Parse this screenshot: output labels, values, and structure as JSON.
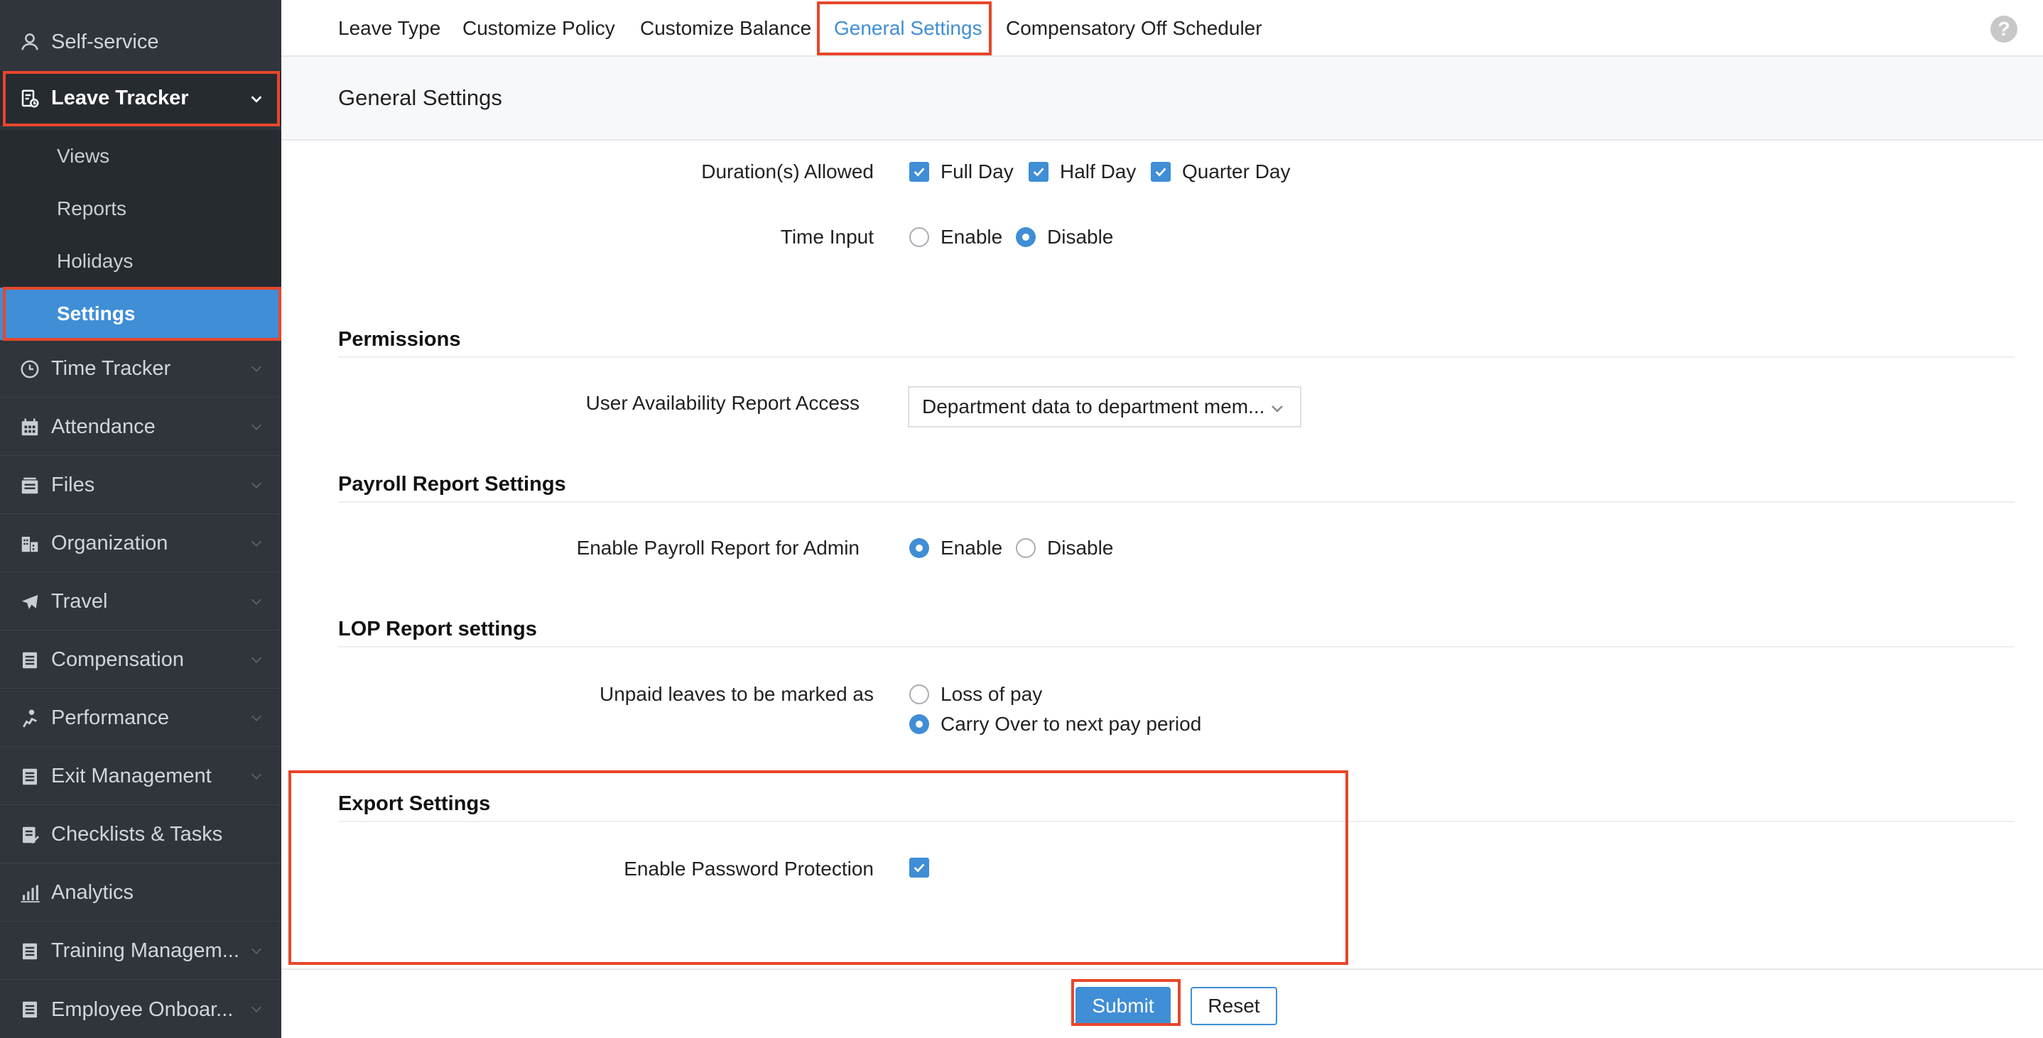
{
  "sidebar": {
    "items": [
      {
        "label": "Self-service",
        "icon": "user-icon"
      },
      {
        "label": "Leave Tracker",
        "icon": "leave-tracker-icon"
      },
      {
        "label": "Time Tracker",
        "icon": "clock-icon"
      },
      {
        "label": "Attendance",
        "icon": "calendar-icon"
      },
      {
        "label": "Files",
        "icon": "files-icon"
      },
      {
        "label": "Organization",
        "icon": "organization-icon"
      },
      {
        "label": "Travel",
        "icon": "plane-icon"
      },
      {
        "label": "Compensation",
        "icon": "document-icon"
      },
      {
        "label": "Performance",
        "icon": "performance-icon"
      },
      {
        "label": "Exit Management",
        "icon": "document-icon"
      },
      {
        "label": "Checklists & Tasks",
        "icon": "checklist-icon"
      },
      {
        "label": "Analytics",
        "icon": "analytics-icon"
      },
      {
        "label": "Training Managem...",
        "icon": "document-icon"
      },
      {
        "label": "Employee Onboar...",
        "icon": "document-icon"
      }
    ],
    "subitems": [
      {
        "label": "Views"
      },
      {
        "label": "Reports"
      },
      {
        "label": "Holidays"
      },
      {
        "label": "Settings"
      }
    ]
  },
  "tabs": [
    "Leave Type",
    "Customize Policy",
    "Customize Balance",
    "General Settings",
    "Compensatory Off Scheduler"
  ],
  "help_label": "?",
  "page_title": "General Settings",
  "duration": {
    "label": "Duration(s) Allowed",
    "options": [
      "Full Day",
      "Half Day",
      "Quarter Day"
    ]
  },
  "time_input": {
    "label": "Time Input",
    "options": [
      "Enable",
      "Disable"
    ],
    "selected": "Disable"
  },
  "permissions": {
    "heading": "Permissions",
    "label": "User Availability Report Access",
    "value": "Department data to department mem..."
  },
  "payroll": {
    "heading": "Payroll Report Settings",
    "label": "Enable Payroll Report for Admin",
    "options": [
      "Enable",
      "Disable"
    ],
    "selected": "Enable"
  },
  "lop": {
    "heading": "LOP Report settings",
    "label": "Unpaid leaves to be marked as",
    "options": [
      "Loss of pay",
      "Carry Over to next pay period"
    ],
    "selected": "Carry Over to next pay period"
  },
  "export": {
    "heading": "Export Settings",
    "label": "Enable Password Protection",
    "checked": true
  },
  "footer": {
    "submit": "Submit",
    "reset": "Reset"
  },
  "colors": {
    "accent": "#3f8ed6",
    "sidebar": "#2f353b",
    "highlight": "#e8462a"
  }
}
